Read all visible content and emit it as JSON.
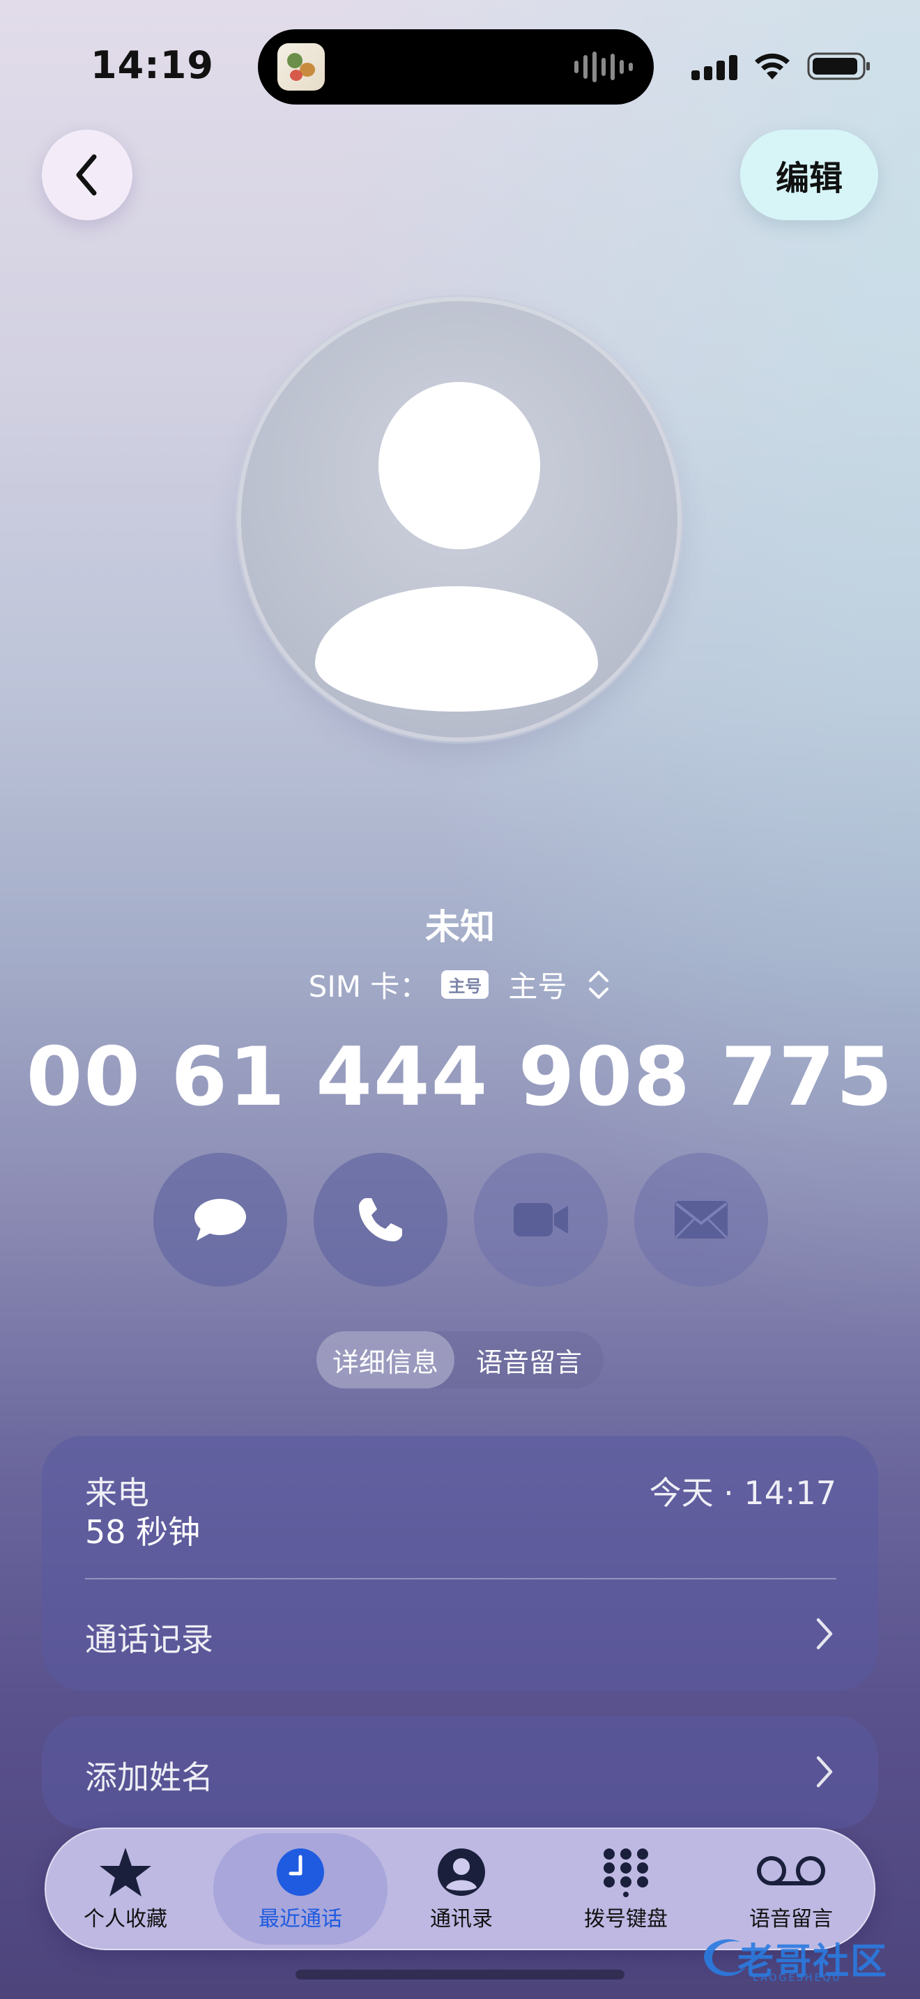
{
  "status_bar": {
    "time": "14:19"
  },
  "nav": {
    "edit_label": "编辑"
  },
  "contact": {
    "name": "未知",
    "sim_prefix": "SIM 卡：",
    "sim_badge": "主号",
    "sim_name": "主号",
    "number": "00 61 444 908 775"
  },
  "actions": [
    {
      "icon": "message-icon"
    },
    {
      "icon": "phone-icon"
    },
    {
      "icon": "video-icon"
    },
    {
      "icon": "mail-icon"
    }
  ],
  "segments": {
    "details": "详细信息",
    "voicemail": "语音留言"
  },
  "call_card": {
    "type": "来电",
    "duration": "58 秒钟",
    "time": "今天 · 14:17",
    "history_label": "通话记录"
  },
  "add_name_label": "添加姓名",
  "tabs": [
    {
      "label": "个人收藏",
      "icon": "star-icon"
    },
    {
      "label": "最近通话",
      "icon": "clock-icon",
      "selected": true
    },
    {
      "label": "通讯录",
      "icon": "person-icon"
    },
    {
      "label": "拨号键盘",
      "icon": "keypad-icon"
    },
    {
      "label": "语音留言",
      "icon": "voicemail-icon"
    }
  ],
  "watermark": {
    "text": "老哥社区",
    "subtext": "LAOGESHEQU"
  },
  "colors": {
    "accent": "#1f5be0"
  }
}
